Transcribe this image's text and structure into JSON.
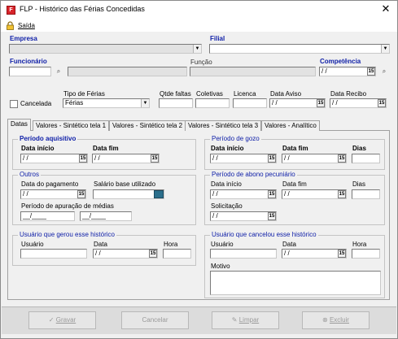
{
  "window": {
    "title": "FLP - Histórico das Férias Concedidas",
    "close_glyph": "✕"
  },
  "menu": {
    "saida": "Saída"
  },
  "header": {
    "empresa_label": "Empresa",
    "filial_label": "Filial",
    "funcionario_label": "Funcionário",
    "funcao_label": "Função",
    "competencia_label": "Competência",
    "competencia_value": "/ /"
  },
  "row2": {
    "cancelada_label": "Cancelada",
    "tipo_ferias_label": "Tipo de Férias",
    "tipo_ferias_value": "Férias",
    "qtde_faltas_label": "Qtde faltas",
    "coletivas_label": "Coletivas",
    "licenca_label": "Licenca",
    "data_aviso_label": "Data Aviso",
    "data_aviso_value": "/ /",
    "data_recibo_label": "Data Recibo",
    "data_recibo_value": "/ /"
  },
  "tabs": [
    "Datas",
    "Valores - Sintético tela 1",
    "Valores - Sintético tela 2",
    "Valores - Sintético tela 3",
    "Valores - Analítico"
  ],
  "periodo_aquisitivo": {
    "title": "Período aquisitivo",
    "data_inicio_label": "Data início",
    "data_inicio_value": "/ /",
    "data_fim_label": "Data fim",
    "data_fim_value": "/ /"
  },
  "periodo_gozo": {
    "title": "Período de gozo",
    "data_inicio_label": "Data início",
    "data_inicio_value": "/ /",
    "data_fim_label": "Data fim",
    "data_fim_value": "/ /",
    "dias_label": "Dias"
  },
  "outros": {
    "title": "Outros",
    "data_pagamento_label": "Data do pagamento",
    "data_pagamento_value": "/ /",
    "salario_base_label": "Salário base utilizado",
    "periodo_apuracao_label": "Período de apuração de médias",
    "periodo_apuracao_inicio": "__/____",
    "periodo_apuracao_fim": "__/____"
  },
  "abono": {
    "title": "Período de abono pecuniário",
    "data_inicio_label": "Data início",
    "data_inicio_value": "/ /",
    "data_fim_label": "Data fim",
    "data_fim_value": "/ /",
    "dias_label": "Dias",
    "solicitacao_label": "Solicitação",
    "solicitacao_value": "/ /"
  },
  "usuario_gerou": {
    "title": "Usuário que gerou esse histórico",
    "usuario_label": "Usuário",
    "data_label": "Data",
    "data_value": "/ /",
    "hora_label": "Hora"
  },
  "usuario_cancelou": {
    "title": "Usuário que cancelou esse histórico",
    "usuario_label": "Usuário",
    "data_label": "Data",
    "data_value": "/ /",
    "hora_label": "Hora",
    "motivo_label": "Motivo"
  },
  "buttons": {
    "gravar": "Gravar",
    "cancelar": "Cancelar",
    "limpar": "Limpar",
    "excluir": "Excluir"
  },
  "icons": {
    "calendar_glyph": "15",
    "binoculars_glyph": "⌕",
    "dropdown_glyph": "▼",
    "app_glyph": "F",
    "check_glyph": "✓",
    "clean_glyph": "✎",
    "delete_glyph": "⊗"
  },
  "colors": {
    "label_blue": "#1020a8",
    "window_bg": "#f0f0f0",
    "app_icon": "#d8242a"
  }
}
